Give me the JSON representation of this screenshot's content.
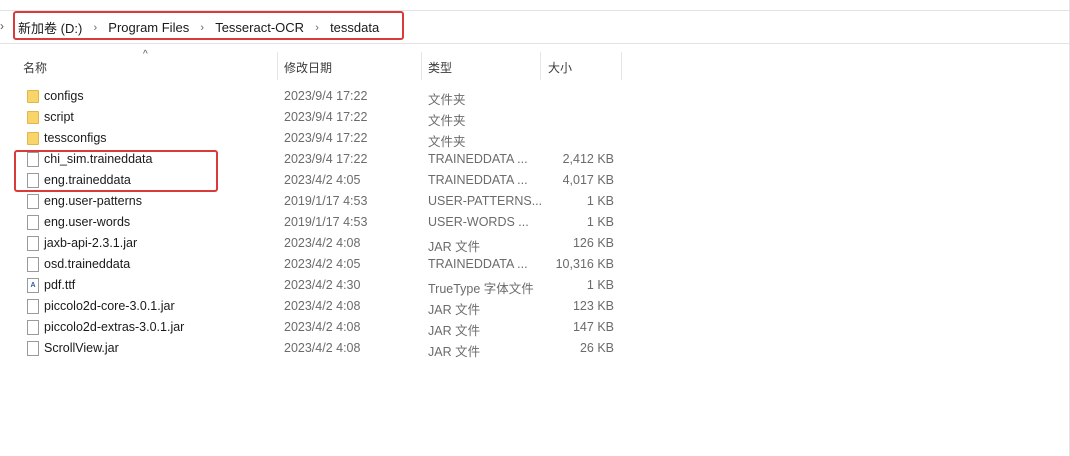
{
  "breadcrumb": {
    "items": [
      "新加卷 (D:)",
      "Program Files",
      "Tesseract-OCR",
      "tessdata"
    ]
  },
  "columns": {
    "name": "名称",
    "date": "修改日期",
    "type": "类型",
    "size": "大小"
  },
  "files": [
    {
      "name": "configs",
      "date": "2023/9/4 17:22",
      "type": "文件夹",
      "size": "",
      "icon": "folder-icon"
    },
    {
      "name": "script",
      "date": "2023/9/4 17:22",
      "type": "文件夹",
      "size": "",
      "icon": "folder-icon"
    },
    {
      "name": "tessconfigs",
      "date": "2023/9/4 17:22",
      "type": "文件夹",
      "size": "",
      "icon": "folder-icon"
    },
    {
      "name": "chi_sim.traineddata",
      "date": "2023/9/4 17:22",
      "type": "TRAINEDDATA ...",
      "size": "2,412 KB",
      "icon": "file-icon"
    },
    {
      "name": "eng.traineddata",
      "date": "2023/4/2 4:05",
      "type": "TRAINEDDATA ...",
      "size": "4,017 KB",
      "icon": "file-icon"
    },
    {
      "name": "eng.user-patterns",
      "date": "2019/1/17 4:53",
      "type": "USER-PATTERNS...",
      "size": "1 KB",
      "icon": "file-icon"
    },
    {
      "name": "eng.user-words",
      "date": "2019/1/17 4:53",
      "type": "USER-WORDS ...",
      "size": "1 KB",
      "icon": "file-icon"
    },
    {
      "name": "jaxb-api-2.3.1.jar",
      "date": "2023/4/2 4:08",
      "type": "JAR 文件",
      "size": "126 KB",
      "icon": "file-icon"
    },
    {
      "name": "osd.traineddata",
      "date": "2023/4/2 4:05",
      "type": "TRAINEDDATA ...",
      "size": "10,316 KB",
      "icon": "file-icon"
    },
    {
      "name": "pdf.ttf",
      "date": "2023/4/2 4:30",
      "type": "TrueType 字体文件",
      "size": "1 KB",
      "icon": "font-icon"
    },
    {
      "name": "piccolo2d-core-3.0.1.jar",
      "date": "2023/4/2 4:08",
      "type": "JAR 文件",
      "size": "123 KB",
      "icon": "file-icon"
    },
    {
      "name": "piccolo2d-extras-3.0.1.jar",
      "date": "2023/4/2 4:08",
      "type": "JAR 文件",
      "size": "147 KB",
      "icon": "file-icon"
    },
    {
      "name": "ScrollView.jar",
      "date": "2023/4/2 4:08",
      "type": "JAR 文件",
      "size": "26 KB",
      "icon": "file-icon"
    }
  ],
  "colors": {
    "highlight": "#d93b3b",
    "folder": "#f7d56b"
  }
}
